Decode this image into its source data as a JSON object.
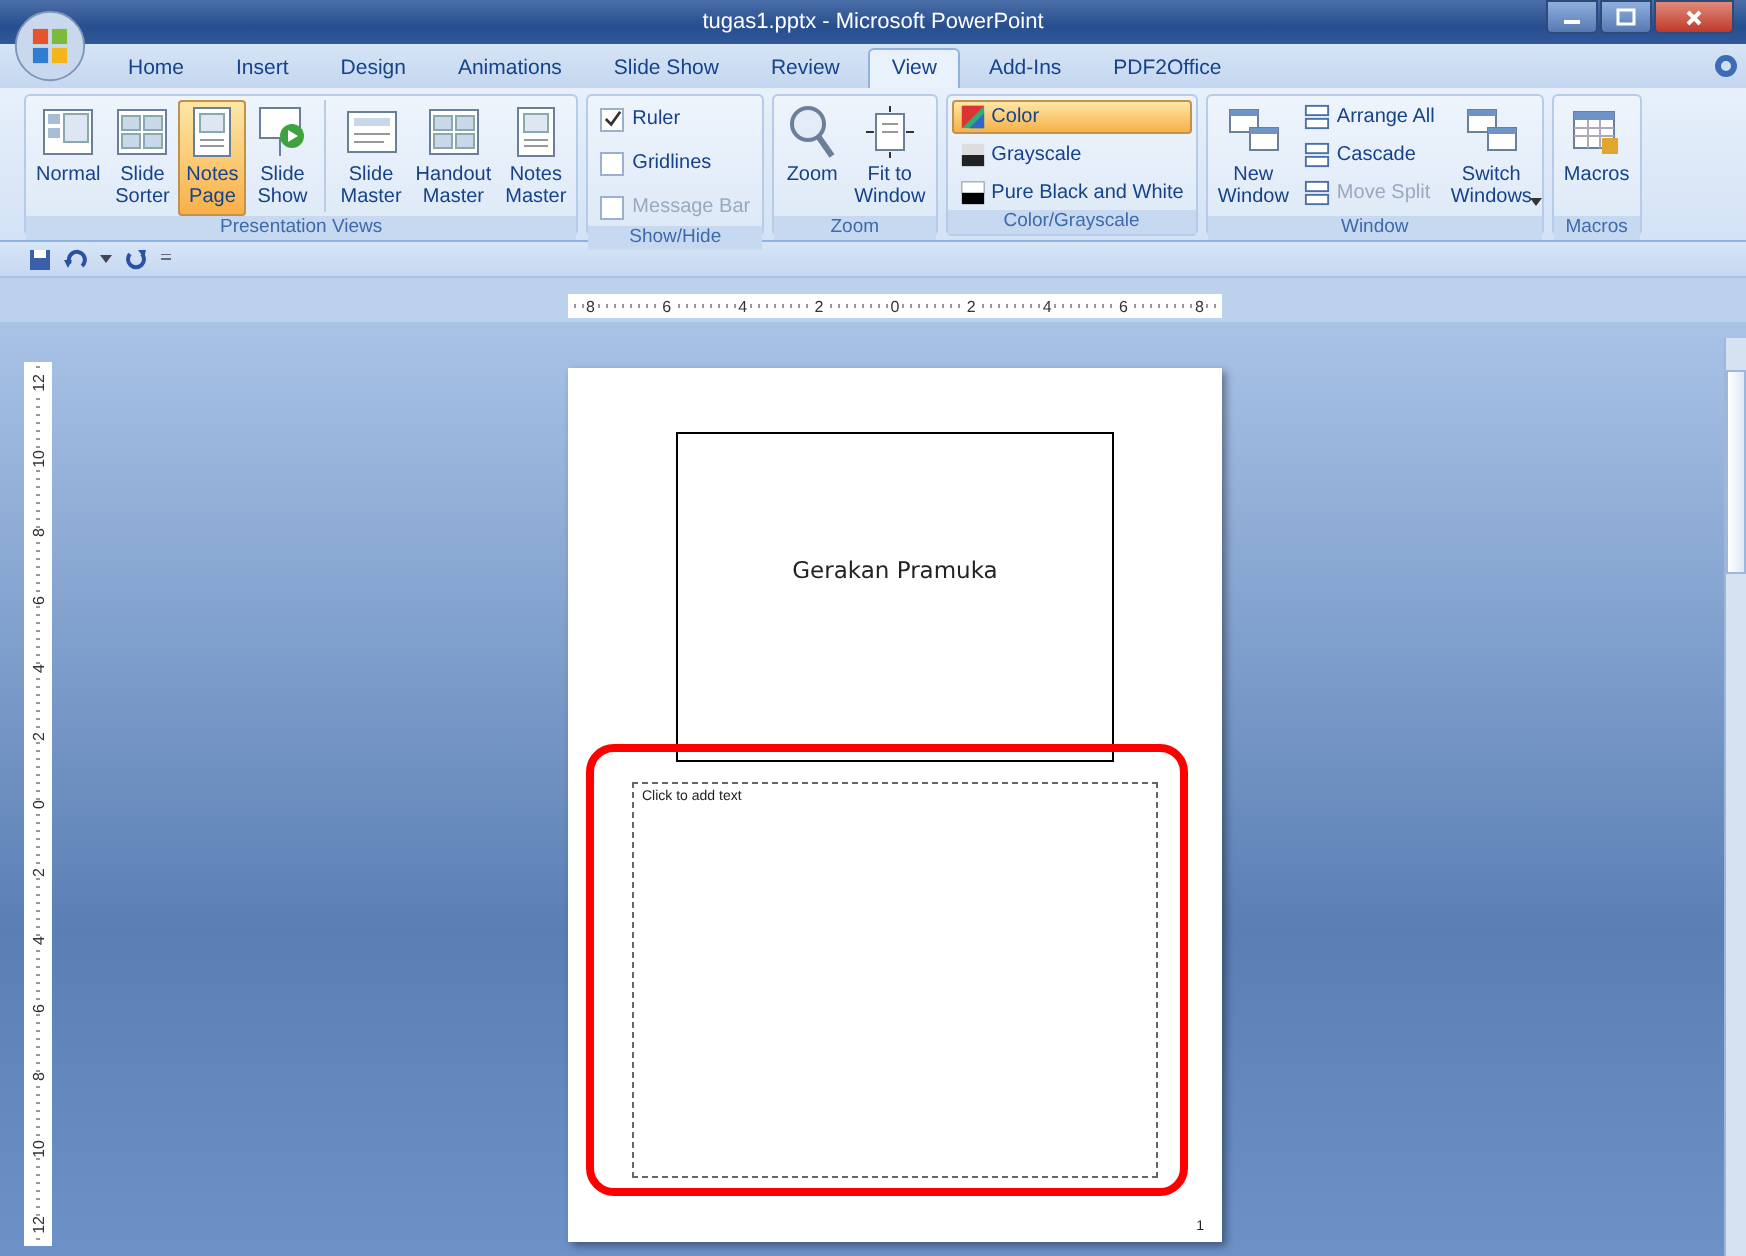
{
  "window": {
    "title": "tugas1.pptx - Microsoft PowerPoint"
  },
  "tabs": [
    {
      "label": "Home",
      "selected": false
    },
    {
      "label": "Insert",
      "selected": false
    },
    {
      "label": "Design",
      "selected": false
    },
    {
      "label": "Animations",
      "selected": false
    },
    {
      "label": "Slide Show",
      "selected": false
    },
    {
      "label": "Review",
      "selected": false
    },
    {
      "label": "View",
      "selected": true
    },
    {
      "label": "Add-Ins",
      "selected": false
    },
    {
      "label": "PDF2Office",
      "selected": false
    }
  ],
  "ribbon_groups": [
    {
      "label": "Presentation Views",
      "items": [
        {
          "kind": "large",
          "label": "Normal",
          "selected": false
        },
        {
          "kind": "large",
          "label": "Slide\nSorter",
          "selected": false
        },
        {
          "kind": "large",
          "label": "Notes\nPage",
          "selected": true
        },
        {
          "kind": "large",
          "label": "Slide\nShow",
          "selected": false
        },
        {
          "kind": "separator"
        },
        {
          "kind": "large",
          "label": "Slide\nMaster",
          "selected": false
        },
        {
          "kind": "large",
          "label": "Handout\nMaster",
          "selected": false
        },
        {
          "kind": "large",
          "label": "Notes\nMaster",
          "selected": false
        }
      ]
    },
    {
      "label": "Show/Hide",
      "items": [
        {
          "kind": "checkbox",
          "label": "Ruler",
          "checked": true,
          "disabled": false
        },
        {
          "kind": "checkbox",
          "label": "Gridlines",
          "checked": false,
          "disabled": false
        },
        {
          "kind": "checkbox",
          "label": "Message Bar",
          "checked": false,
          "disabled": true
        }
      ]
    },
    {
      "label": "Zoom",
      "items": [
        {
          "kind": "large",
          "label": "Zoom",
          "selected": false
        },
        {
          "kind": "large",
          "label": "Fit to\nWindow",
          "selected": false
        }
      ]
    },
    {
      "label": "Color/Grayscale",
      "items": [
        {
          "kind": "small",
          "label": "Color",
          "selected": true,
          "disabled": false
        },
        {
          "kind": "small",
          "label": "Grayscale",
          "selected": false,
          "disabled": false
        },
        {
          "kind": "small",
          "label": "Pure Black and White",
          "selected": false,
          "disabled": false
        }
      ]
    },
    {
      "label": "Window",
      "items": [
        {
          "kind": "large",
          "label": "New\nWindow",
          "selected": false
        },
        {
          "kind": "small",
          "label": "Arrange All",
          "selected": false,
          "disabled": false
        },
        {
          "kind": "small",
          "label": "Cascade",
          "selected": false,
          "disabled": false
        },
        {
          "kind": "small",
          "label": "Move Split",
          "selected": false,
          "disabled": true
        },
        {
          "kind": "large",
          "label": "Switch\nWindows",
          "selected": false,
          "has_menu": true
        }
      ]
    },
    {
      "label": "Macros",
      "items": [
        {
          "kind": "large",
          "label": "Macros",
          "selected": false
        }
      ]
    }
  ],
  "horizontal_ruler": {
    "labels": [
      "8",
      "6",
      "4",
      "2",
      "0",
      "2",
      "4",
      "6",
      "8"
    ]
  },
  "vertical_ruler": {
    "labels": [
      "12",
      "10",
      "8",
      "6",
      "4",
      "2",
      "0",
      "2",
      "4",
      "6",
      "8",
      "10",
      "12"
    ]
  },
  "notes_page": {
    "slide_title": "Gerakan Pramuka",
    "notes_placeholder": "Click to add text",
    "page_number": "1"
  }
}
